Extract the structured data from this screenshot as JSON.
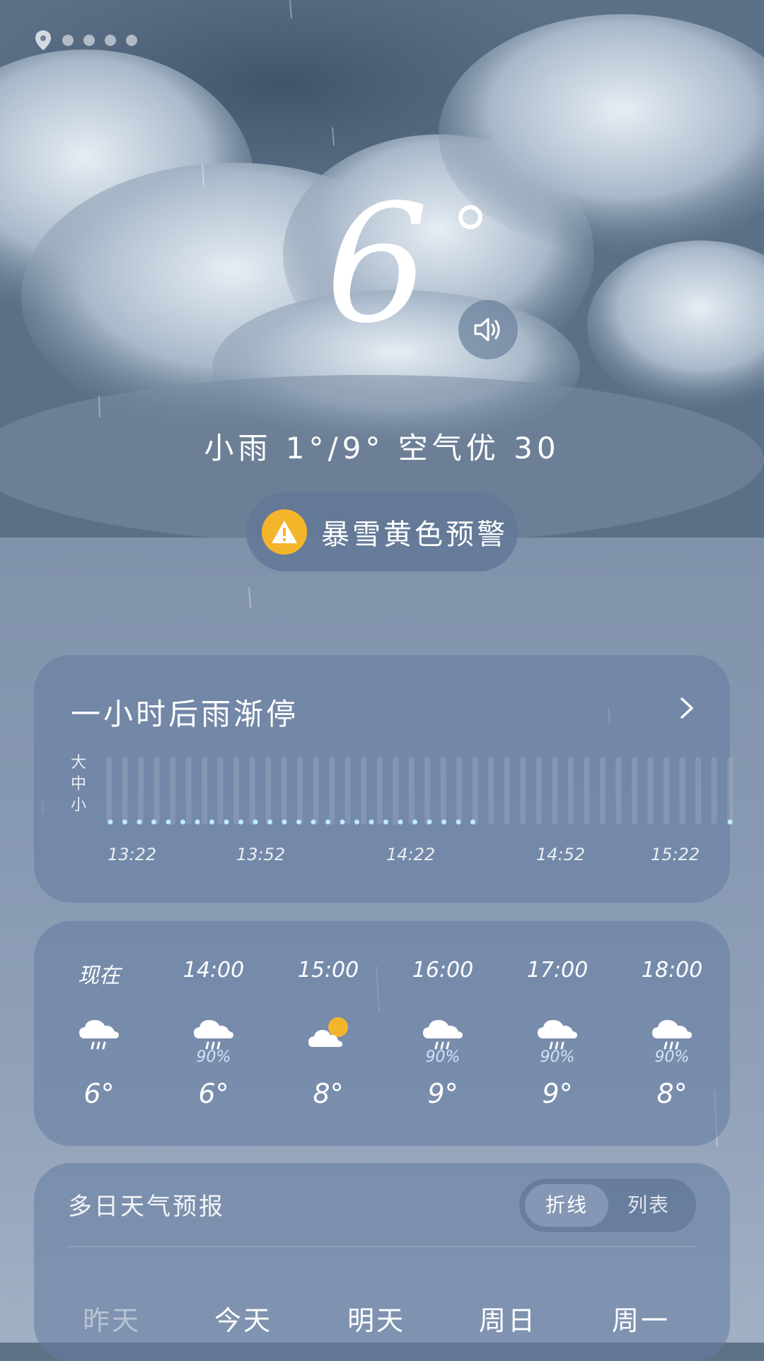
{
  "current": {
    "temperature": "6",
    "summary": "小雨 1°/9° 空气优 30"
  },
  "alert": {
    "text": "暴雪黄色预警"
  },
  "minutely": {
    "title": "一小时后雨渐停",
    "intensity_labels": [
      "大",
      "中",
      "小"
    ],
    "ticks": [
      "13:22",
      "13:52",
      "14:22",
      "14:52",
      "15:22"
    ]
  },
  "hourly": [
    {
      "time": "现在",
      "icon": "cloud-rain-icon",
      "pop": "",
      "temp": "6°"
    },
    {
      "time": "14:00",
      "icon": "cloud-rain-icon",
      "pop": "90%",
      "temp": "6°"
    },
    {
      "time": "15:00",
      "icon": "cloud-sun-icon",
      "pop": "",
      "temp": "8°"
    },
    {
      "time": "16:00",
      "icon": "cloud-rain-icon",
      "pop": "90%",
      "temp": "9°"
    },
    {
      "time": "17:00",
      "icon": "cloud-rain-icon",
      "pop": "90%",
      "temp": "9°"
    },
    {
      "time": "18:00",
      "icon": "cloud-rain-icon",
      "pop": "90%",
      "temp": "8°"
    }
  ],
  "daily": {
    "title": "多日天气预报",
    "toggle": {
      "option_line": "折线",
      "option_list": "列表"
    },
    "days": [
      "昨天",
      "今天",
      "明天",
      "周日",
      "周一"
    ]
  },
  "colors": {
    "alert": "#f5b52a",
    "rain_dot": "#bfe9ff"
  }
}
